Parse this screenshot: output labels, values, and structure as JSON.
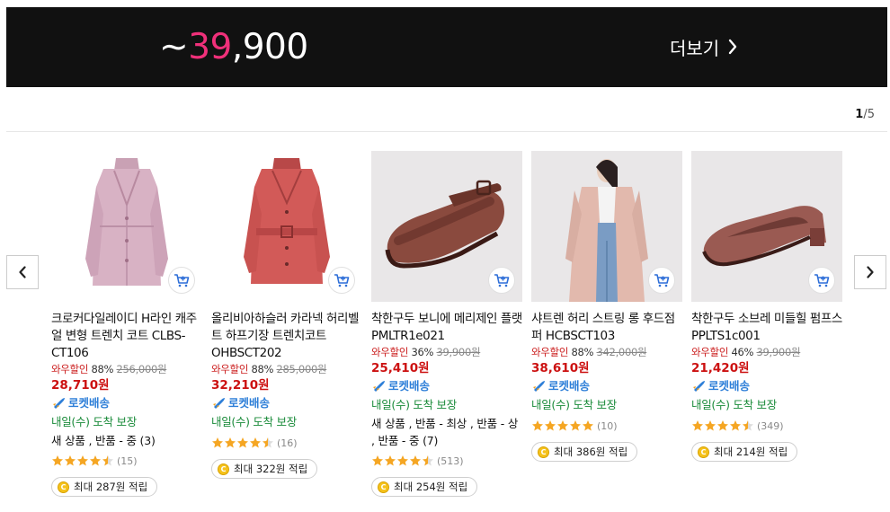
{
  "banner": {
    "price_prefix": "~",
    "price_highlight": "39",
    "price_rest": ",900",
    "more_label": "더보기",
    "highlight_color": "#f0307a"
  },
  "pager": {
    "current": "1",
    "total": "/5"
  },
  "products": [
    {
      "name": "크로커다일레이디 H라인 캐주얼 변형 트렌치 코트 CLBS-CT106",
      "discount_label": "와우할인",
      "discount_pct": "88%",
      "original_price": "256,000원",
      "sale_price": "28,710원",
      "rocket_label": "로켓배송",
      "arrival": "내일(수) 도착 보장",
      "stock_note": "새 상품 , 반품 - 중 (3)",
      "rating": 4.5,
      "review_count": "(15)",
      "points": "최대 287원 적립"
    },
    {
      "name": "올리비아하슬러 카라넥 허리벨트 하프기장 트렌치코트 OHBSCT202",
      "discount_label": "와우할인",
      "discount_pct": "88%",
      "original_price": "285,000원",
      "sale_price": "32,210원",
      "rocket_label": "로켓배송",
      "arrival": "내일(수) 도착 보장",
      "stock_note": "",
      "rating": 4.5,
      "review_count": "(16)",
      "points": "최대 322원 적립"
    },
    {
      "name": "착한구두 보니에 메리제인 플랫 PMLTR1e021",
      "discount_label": "와우할인",
      "discount_pct": "36%",
      "original_price": "39,900원",
      "sale_price": "25,410원",
      "rocket_label": "로켓배송",
      "arrival": "내일(수) 도착 보장",
      "stock_note": "새 상품 , 반품 - 최상 , 반품 - 상 , 반품 - 중 (7)",
      "rating": 4.5,
      "review_count": "(513)",
      "points": "최대 254원 적립"
    },
    {
      "name": "샤트렌 허리 스트링 롱 후드점퍼 HCBSCT103",
      "discount_label": "와우할인",
      "discount_pct": "88%",
      "original_price": "342,000원",
      "sale_price": "38,610원",
      "rocket_label": "로켓배송",
      "arrival": "내일(수) 도착 보장",
      "stock_note": "",
      "rating": 5,
      "review_count": "(10)",
      "points": "최대 386원 적립"
    },
    {
      "name": "착한구두 소브레 미들힐 펌프스 PPLTS1c001",
      "discount_label": "와우할인",
      "discount_pct": "46%",
      "original_price": "39,900원",
      "sale_price": "21,420원",
      "rocket_label": "로켓배송",
      "arrival": "내일(수) 도착 보장",
      "stock_note": "",
      "rating": 4.5,
      "review_count": "(349)",
      "points": "최대 214원 적립"
    }
  ]
}
